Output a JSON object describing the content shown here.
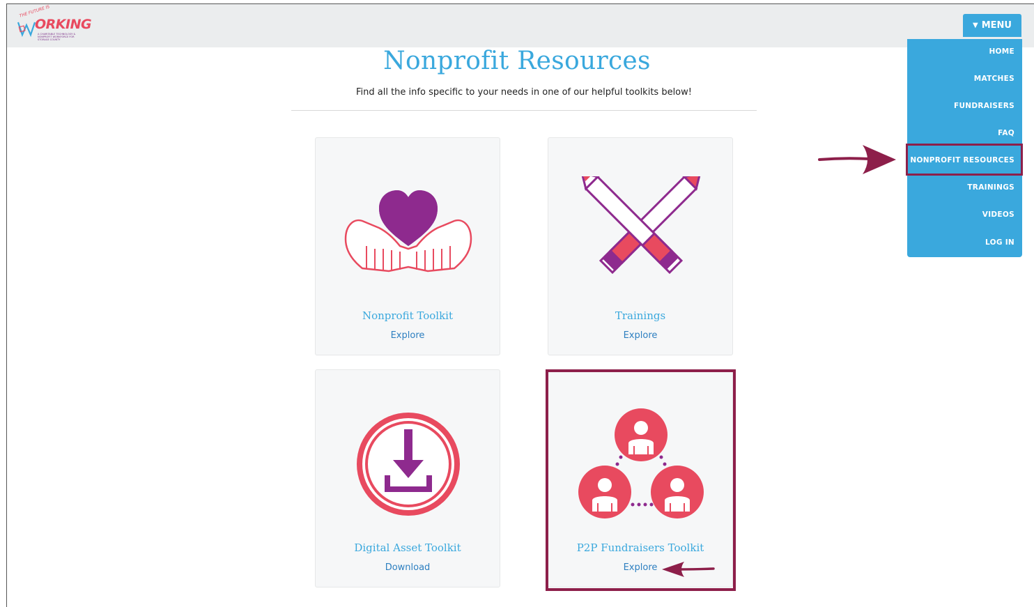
{
  "brand": {
    "logo_top": "THE FUTURE IS",
    "logo_main": "ORKING",
    "logo_sub": "A CHARITABLE TECHNOLOGY & NONPROFIT WORKFORCE FOR STORAGE COUNTY"
  },
  "menu": {
    "button_label": "MENU",
    "items": [
      {
        "label": "HOME"
      },
      {
        "label": "MATCHES"
      },
      {
        "label": "FUNDRAISERS"
      },
      {
        "label": "FAQ"
      },
      {
        "label": "NONPROFIT RESOURCES"
      },
      {
        "label": "TRAININGS"
      },
      {
        "label": "VIDEOS"
      },
      {
        "label": "LOG IN"
      }
    ]
  },
  "page": {
    "title": "Nonprofit Resources",
    "subtitle": "Find all the info specific to your needs in one of our helpful toolkits below!"
  },
  "cards": [
    {
      "title": "Nonprofit Toolkit",
      "link": "Explore",
      "icon": "heart-hands-icon"
    },
    {
      "title": "Trainings",
      "link": "Explore",
      "icon": "crossed-pencils-icon"
    },
    {
      "title": "Digital Asset Toolkit",
      "link": "Download",
      "icon": "download-icon"
    },
    {
      "title": "P2P Fundraisers Toolkit",
      "link": "Explore",
      "icon": "people-network-icon"
    }
  ],
  "colors": {
    "brand_blue": "#3aa8dd",
    "accent_red": "#e84a5f",
    "accent_purple": "#8e2a8e",
    "annotation": "#8d1f4a"
  }
}
